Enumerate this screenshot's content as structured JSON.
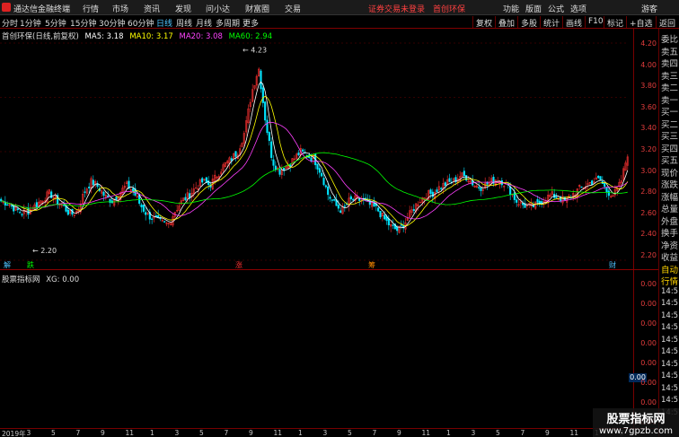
{
  "topbar": {
    "app_name": "通达信金融终端",
    "menus": [
      "行情",
      "市场",
      "资讯",
      "发现",
      "问小达",
      "财富圈",
      "交易"
    ],
    "notice": "证券交易未登录",
    "stock_short": "首创环保",
    "right_menus": [
      "功能",
      "版面",
      "公式",
      "选项"
    ],
    "user": "游客"
  },
  "periods": [
    "分时",
    "1分钟",
    "5分钟",
    "15分钟",
    "30分钟",
    "60分钟",
    "日线",
    "周线",
    "月线",
    "多周期",
    "更多"
  ],
  "active_period": "日线",
  "toolbar_right": [
    "复权",
    "叠加",
    "多股",
    "统计",
    "画线",
    "F10",
    "标记",
    "+自选",
    "返回"
  ],
  "legend": {
    "title": "首创环保(日线,前复权)",
    "ma5": "MA5: 3.18",
    "ma10": "MA10: 3.17",
    "ma20": "MA20: 3.08",
    "ma60": "MA60: 2.94",
    "colors": {
      "ma5": "#ffffff",
      "ma10": "#ffff00",
      "ma20": "#ff40ff",
      "ma60": "#00ff00"
    }
  },
  "indicator": {
    "title": "股票指标网",
    "xg": "XG: 0.00",
    "value_box": "0.00"
  },
  "price_axis": [
    "4.20",
    "4.00",
    "3.80",
    "3.60",
    "3.40",
    "3.20",
    "3.00",
    "2.80",
    "2.60",
    "2.40",
    "2.20"
  ],
  "indicator_axis": [
    "0.00",
    "0.00",
    "0.00",
    "0.00",
    "0.00",
    "0.00",
    "0.00",
    "0.00"
  ],
  "high_label": "4.23",
  "low_label": "2.20",
  "events": [
    "解",
    "跌",
    "涨",
    "筹",
    "财"
  ],
  "time_axis": [
    "2019年",
    "3",
    "5",
    "7",
    "9",
    "11",
    "1",
    "3",
    "5",
    "7",
    "9",
    "11",
    "1",
    "3",
    "5",
    "7",
    "9",
    "11",
    "1",
    "3",
    "5",
    "7",
    "9",
    "11",
    "1",
    "3"
  ],
  "right_panel_labels": [
    "委比",
    "卖五",
    "卖四",
    "卖三",
    "卖二",
    "卖一",
    "买一",
    "买二",
    "买三",
    "买四",
    "买五",
    "现价",
    "涨跌",
    "涨幅",
    "总量",
    "外盘",
    "换手",
    "净资",
    "收益",
    "自动",
    "行情",
    "14:5",
    "14:5",
    "14:5",
    "14:5",
    "14:5",
    "14:5",
    "14:5",
    "14:5",
    "14:5",
    "14:5",
    "14:5"
  ],
  "watermark": {
    "line1": "股票指标网",
    "line2": "www.7gpzb.com"
  },
  "chart_data": {
    "type": "candlestick",
    "title": "首创环保(日线,前复权)",
    "ylim": [
      2.1,
      4.3
    ],
    "series": [
      {
        "name": "close",
        "values": [
          2.7,
          2.68,
          2.62,
          2.58,
          2.6,
          2.66,
          2.72,
          2.78,
          2.7,
          2.64,
          2.56,
          2.6,
          2.8,
          2.9,
          2.84,
          2.74,
          2.7,
          2.78,
          2.86,
          2.8,
          2.66,
          2.56,
          2.52,
          2.48,
          2.46,
          2.6,
          2.7,
          2.76,
          2.84,
          2.9,
          2.86,
          2.96,
          3.06,
          3.12,
          3.2,
          3.4,
          3.8,
          4.05,
          3.5,
          3.1,
          3.0,
          3.06,
          3.12,
          3.2,
          3.16,
          3.12,
          2.98,
          2.76,
          2.66,
          2.6,
          2.7,
          2.72,
          2.7,
          2.66,
          2.62,
          2.52,
          2.44,
          2.4,
          2.48,
          2.6,
          2.7,
          2.76,
          2.78,
          2.84,
          2.88,
          2.9,
          2.96,
          2.94,
          2.86,
          2.84,
          2.88,
          2.92,
          2.9,
          2.82,
          2.7,
          2.66,
          2.64,
          2.66,
          2.72,
          2.76,
          2.74,
          2.7,
          2.76,
          2.82,
          2.86,
          2.9,
          2.92,
          2.8,
          2.76,
          2.88,
          3.18
        ]
      },
      {
        "name": "MA5",
        "values": []
      },
      {
        "name": "MA10",
        "values": []
      },
      {
        "name": "MA20",
        "values": []
      },
      {
        "name": "MA60",
        "values": []
      }
    ]
  }
}
